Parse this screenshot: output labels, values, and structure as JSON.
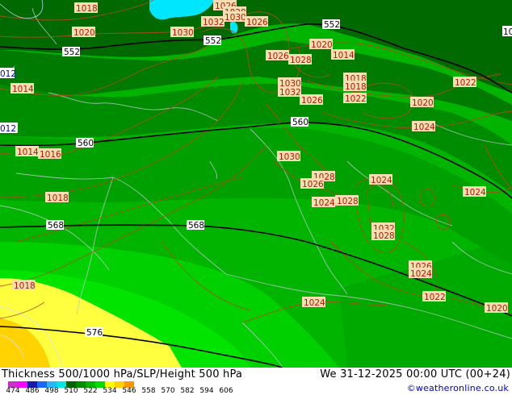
{
  "footer": {
    "title": "Thickness 500/1000 hPa/SLP/Height 500 hPa",
    "datetime": "We 31-12-2025 00:00 UTC (00+24)",
    "credit": "©weatheronline.co.uk"
  },
  "legend": {
    "ticks": [
      "474",
      "486",
      "498",
      "510",
      "522",
      "534",
      "546",
      "558",
      "570",
      "582",
      "594",
      "606"
    ],
    "colors": [
      "#c830c8",
      "#ff00ff",
      "#1a1aa8",
      "#1e64ff",
      "#2db4ff",
      "#00e6e6",
      "#006400",
      "#008c00",
      "#00b400",
      "#00dc00",
      "#ffff00",
      "#ffd200",
      "#ff9600"
    ]
  },
  "map": {
    "thickness_colors": {
      "t546": "#006a00",
      "t552": "#007a00",
      "t558": "#008c00",
      "t564": "#00a000",
      "t570": "#00b400",
      "t576": "#00d000",
      "t582": "#00e400",
      "t588": "#ffff40",
      "t594": "#ffd200",
      "lake": "#00e6ff"
    },
    "height_labels": [
      {
        "id": "h552a",
        "text": "552"
      },
      {
        "id": "h552b",
        "text": "552"
      },
      {
        "id": "h552c",
        "text": "552"
      },
      {
        "id": "h560a",
        "text": "560"
      },
      {
        "id": "h560b",
        "text": "560"
      },
      {
        "id": "h568a",
        "text": "568"
      },
      {
        "id": "h568b",
        "text": "568"
      },
      {
        "id": "h576a",
        "text": "576"
      }
    ],
    "slp_labels": [
      {
        "id": "p1",
        "text": "1018"
      },
      {
        "id": "p2",
        "text": "1020"
      },
      {
        "id": "p3",
        "text": "1026"
      },
      {
        "id": "p4",
        "text": "1028"
      },
      {
        "id": "p5",
        "text": "1030"
      },
      {
        "id": "p6",
        "text": "1032"
      },
      {
        "id": "p7",
        "text": "1026"
      },
      {
        "id": "p8",
        "text": "1030"
      },
      {
        "id": "p9",
        "text": "1020"
      },
      {
        "id": "p10",
        "text": "1014"
      },
      {
        "id": "p11",
        "text": "1026"
      },
      {
        "id": "p12",
        "text": "1028"
      },
      {
        "id": "p13",
        "text": "1030"
      },
      {
        "id": "p14",
        "text": "1032"
      },
      {
        "id": "p15",
        "text": "1026"
      },
      {
        "id": "p16",
        "text": "1018"
      },
      {
        "id": "p17",
        "text": "1018"
      },
      {
        "id": "p18",
        "text": "1022"
      },
      {
        "id": "p19",
        "text": "1020"
      },
      {
        "id": "p20",
        "text": "1022"
      },
      {
        "id": "p21",
        "text": "1014"
      },
      {
        "id": "p22",
        "text": "1024"
      },
      {
        "id": "p23",
        "text": "1014"
      },
      {
        "id": "p24",
        "text": "1016"
      },
      {
        "id": "p25",
        "text": "1030"
      },
      {
        "id": "p26",
        "text": "1028"
      },
      {
        "id": "p27",
        "text": "1026"
      },
      {
        "id": "p28",
        "text": "1024"
      },
      {
        "id": "p29",
        "text": "1024"
      },
      {
        "id": "p30",
        "text": "1028"
      },
      {
        "id": "p31",
        "text": "1018"
      },
      {
        "id": "p32",
        "text": "1024"
      },
      {
        "id": "p33",
        "text": "1032"
      },
      {
        "id": "p34",
        "text": "1028"
      },
      {
        "id": "p35",
        "text": "1026"
      },
      {
        "id": "p36",
        "text": "1024"
      },
      {
        "id": "p37",
        "text": "1022"
      },
      {
        "id": "p38",
        "text": "1018"
      },
      {
        "id": "p39",
        "text": "1024"
      },
      {
        "id": "p40",
        "text": "1020"
      }
    ],
    "edge_labels": [
      {
        "id": "e1",
        "text": "012"
      },
      {
        "id": "e2",
        "text": "012"
      },
      {
        "id": "e3",
        "text": "10"
      }
    ]
  }
}
